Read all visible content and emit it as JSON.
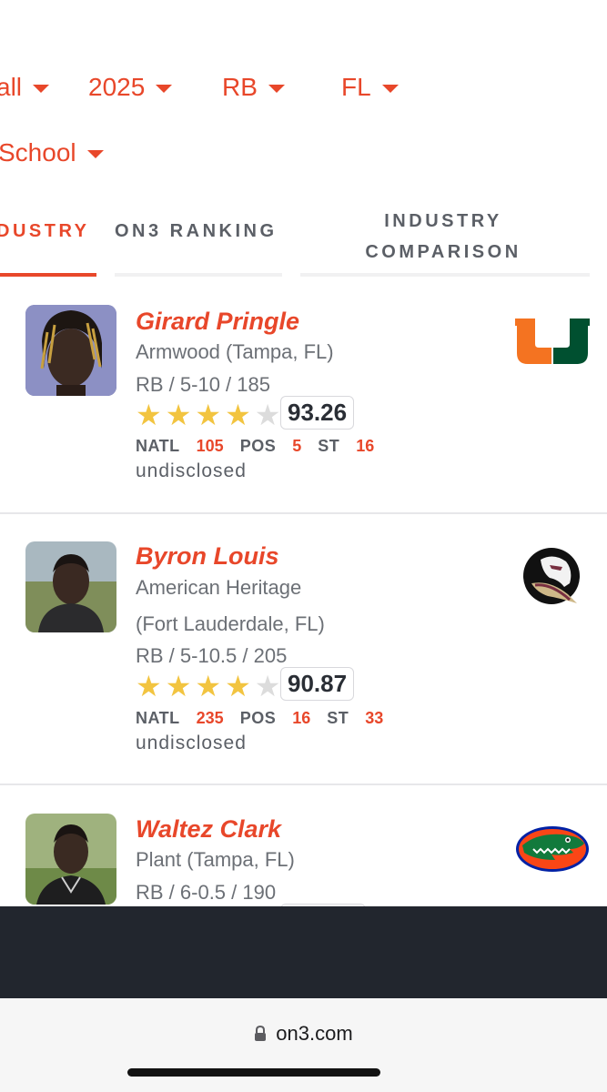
{
  "filters": {
    "sport": "all",
    "year": "2025",
    "position": "RB",
    "state": "FL",
    "school": "School"
  },
  "tabs": [
    {
      "label": "DUSTRY"
    },
    {
      "label": "ON3 RANKING"
    },
    {
      "label_line1": "INDUSTRY",
      "label_line2": "COMPARISON"
    }
  ],
  "players": [
    {
      "name": "Girard Pringle",
      "school": "Armwood (Tampa, FL)",
      "school_line2": "",
      "details": "RB / 5-10 / 185",
      "stars": 4,
      "rating": "93.26",
      "natl_label": "NATL",
      "natl": "105",
      "pos_label": "POS",
      "pos": "5",
      "st_label": "ST",
      "st": "16",
      "status": "undisclosed",
      "team_logo": "miami-u-logo"
    },
    {
      "name": "Byron Louis",
      "school": "American Heritage",
      "school_line2": "(Fort Lauderdale, FL)",
      "details": "RB / 5-10.5 / 205",
      "stars": 4,
      "rating": "90.87",
      "natl_label": "NATL",
      "natl": "235",
      "pos_label": "POS",
      "pos": "16",
      "st_label": "ST",
      "st": "33",
      "status": "undisclosed",
      "team_logo": "florida-state-seminole-logo"
    },
    {
      "name": "Waltez Clark",
      "school": "Plant (Tampa, FL)",
      "details": "RB / 6-0.5 / 190",
      "team_logo": "florida-gator-logo"
    }
  ],
  "browser": {
    "url": "on3.com",
    "lock_icon": "lock-icon"
  },
  "colors": {
    "accent": "#e8472a",
    "star": "#f2c440",
    "dark_bar": "#22262e"
  }
}
